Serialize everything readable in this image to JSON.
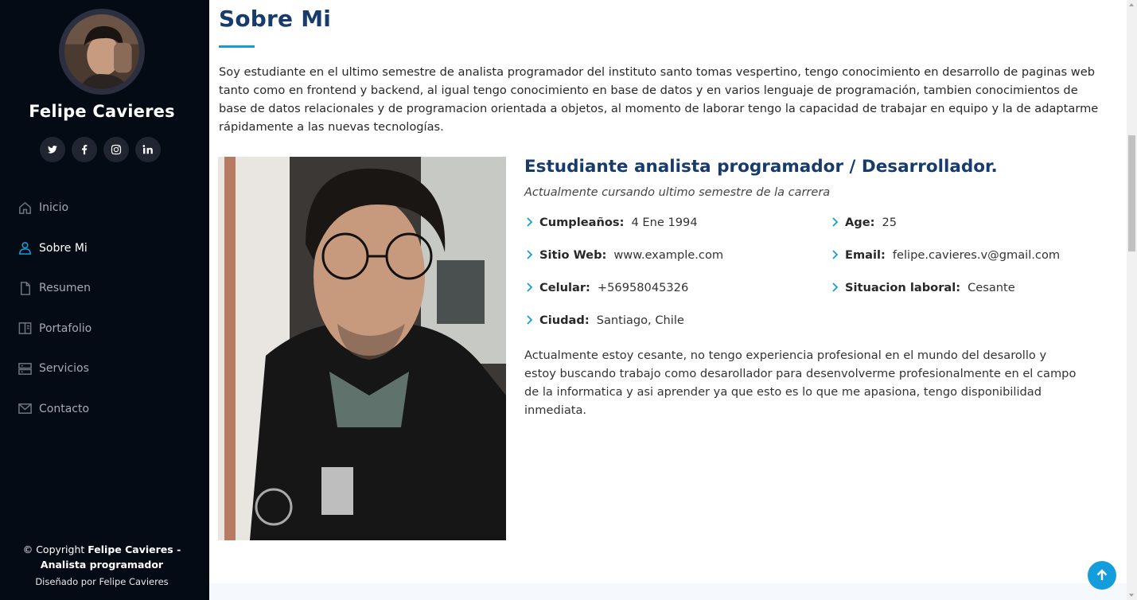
{
  "profile": {
    "name": "Felipe Cavieres",
    "social": [
      {
        "icon": "twitter-icon"
      },
      {
        "icon": "facebook-icon"
      },
      {
        "icon": "instagram-icon"
      },
      {
        "icon": "linkedin-icon"
      }
    ]
  },
  "nav": {
    "items": [
      {
        "label": "Inicio",
        "icon": "home-icon",
        "active": false
      },
      {
        "label": "Sobre Mi",
        "icon": "person-icon",
        "active": true
      },
      {
        "label": "Resumen",
        "icon": "file-icon",
        "active": false
      },
      {
        "label": "Portafolio",
        "icon": "book-icon",
        "active": false
      },
      {
        "label": "Servicios",
        "icon": "server-icon",
        "active": false
      },
      {
        "label": "Contacto",
        "icon": "envelope-icon",
        "active": false
      }
    ]
  },
  "footer": {
    "copyright_prefix": "© Copyright ",
    "copyright_name": "Felipe Cavieres -",
    "copyright_role": "Analista programador",
    "credits": "Diseñado por Felipe Cavieres"
  },
  "about": {
    "title": "Sobre Mi",
    "intro": "Soy estudiante en el ultimo semestre de analista programador del instituto santo tomas vespertino, tengo conocimiento en desarrollo de paginas web tanto como en frontend y backend, al igual tengo conocimiento en base de datos y en varios lenguaje de programación, tambien conocimientos de base de datos relacionales y de programacion orientada a objetos, al momento de laborar tengo la capacidad de trabajar en equipo y la de adaptarme rápidamente a las nuevas tecnologías.",
    "role": "Estudiante analista programador / Desarrollador.",
    "subtitle": "Actualmente cursando ultimo semestre de la carrera",
    "info": {
      "birthday_label": "Cumpleaños:",
      "birthday": "4 Ene 1994",
      "age_label": "Age:",
      "age": "25",
      "website_label": "Sitio Web:",
      "website": "www.example.com",
      "email_label": "Email:",
      "email": "felipe.cavieres.v@gmail.com",
      "phone_label": "Celular:",
      "phone": "+56958045326",
      "status_label": "Situacion laboral:",
      "status": "Cesante",
      "city_label": "Ciudad:",
      "city": "Santiago, Chile"
    },
    "description": "Actualmente estoy cesante, no tengo experiencia profesional en el mundo del desarollo y estoy buscando trabajo como desarollador para desenvolverme profesionalmente en el campo de la informatica y asi aprender ya que esto es lo que me apasiona, tengo disponibilidad inmediata."
  },
  "colors": {
    "accent": "#149ddd",
    "heading": "#173b6c",
    "sidebar_bg": "#040b14"
  }
}
